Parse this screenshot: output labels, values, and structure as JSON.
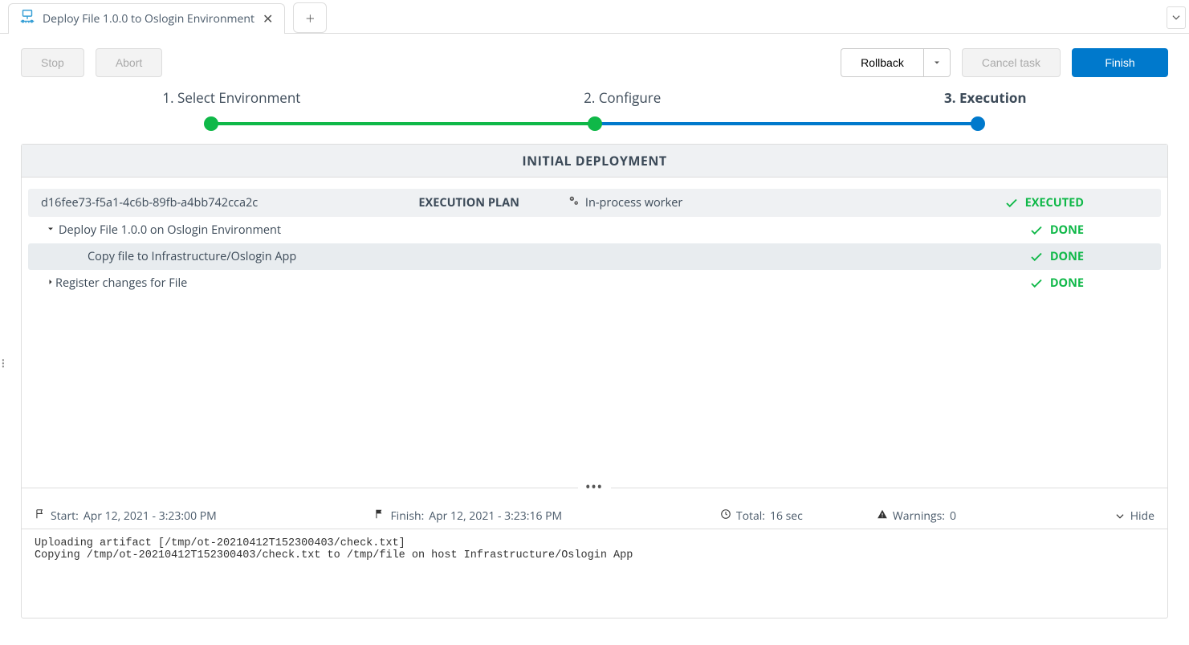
{
  "tab": {
    "title": "Deploy File 1.0.0 to Oslogin Environment"
  },
  "toolbar": {
    "stop": "Stop",
    "abort": "Abort",
    "rollback": "Rollback",
    "cancel_task": "Cancel task",
    "finish": "Finish"
  },
  "stepper": {
    "step1": "1. Select Environment",
    "step2": "2. Configure",
    "step3": "3. Execution"
  },
  "panel": {
    "title": "INITIAL DEPLOYMENT",
    "plan_id": "d16fee73-f5a1-4c6b-89fb-a4bb742cca2c",
    "exec_plan_label": "EXECUTION PLAN",
    "worker": "In-process worker",
    "executed_status": "EXECUTED",
    "rows": {
      "r1": {
        "label": "Deploy File 1.0.0 on Oslogin Environment",
        "status": "DONE"
      },
      "r1a": {
        "label": "Copy file to Infrastructure/Oslogin App",
        "status": "DONE"
      },
      "r2": {
        "label": "Register changes for File",
        "status": "DONE"
      }
    }
  },
  "log_meta": {
    "start_label": "Start: ",
    "start_value": "Apr 12, 2021 - 3:23:00 PM",
    "finish_label": "Finish: ",
    "finish_value": "Apr 12, 2021 - 3:23:16 PM",
    "total_label": "Total: ",
    "total_value": "16 sec",
    "warnings_label": "Warnings: ",
    "warnings_value": "0",
    "hide": "Hide"
  },
  "log_output": "Uploading artifact [/tmp/ot-20210412T152300403/check.txt]\nCopying /tmp/ot-20210412T152300403/check.txt to /tmp/file on host Infrastructure/Oslogin App"
}
